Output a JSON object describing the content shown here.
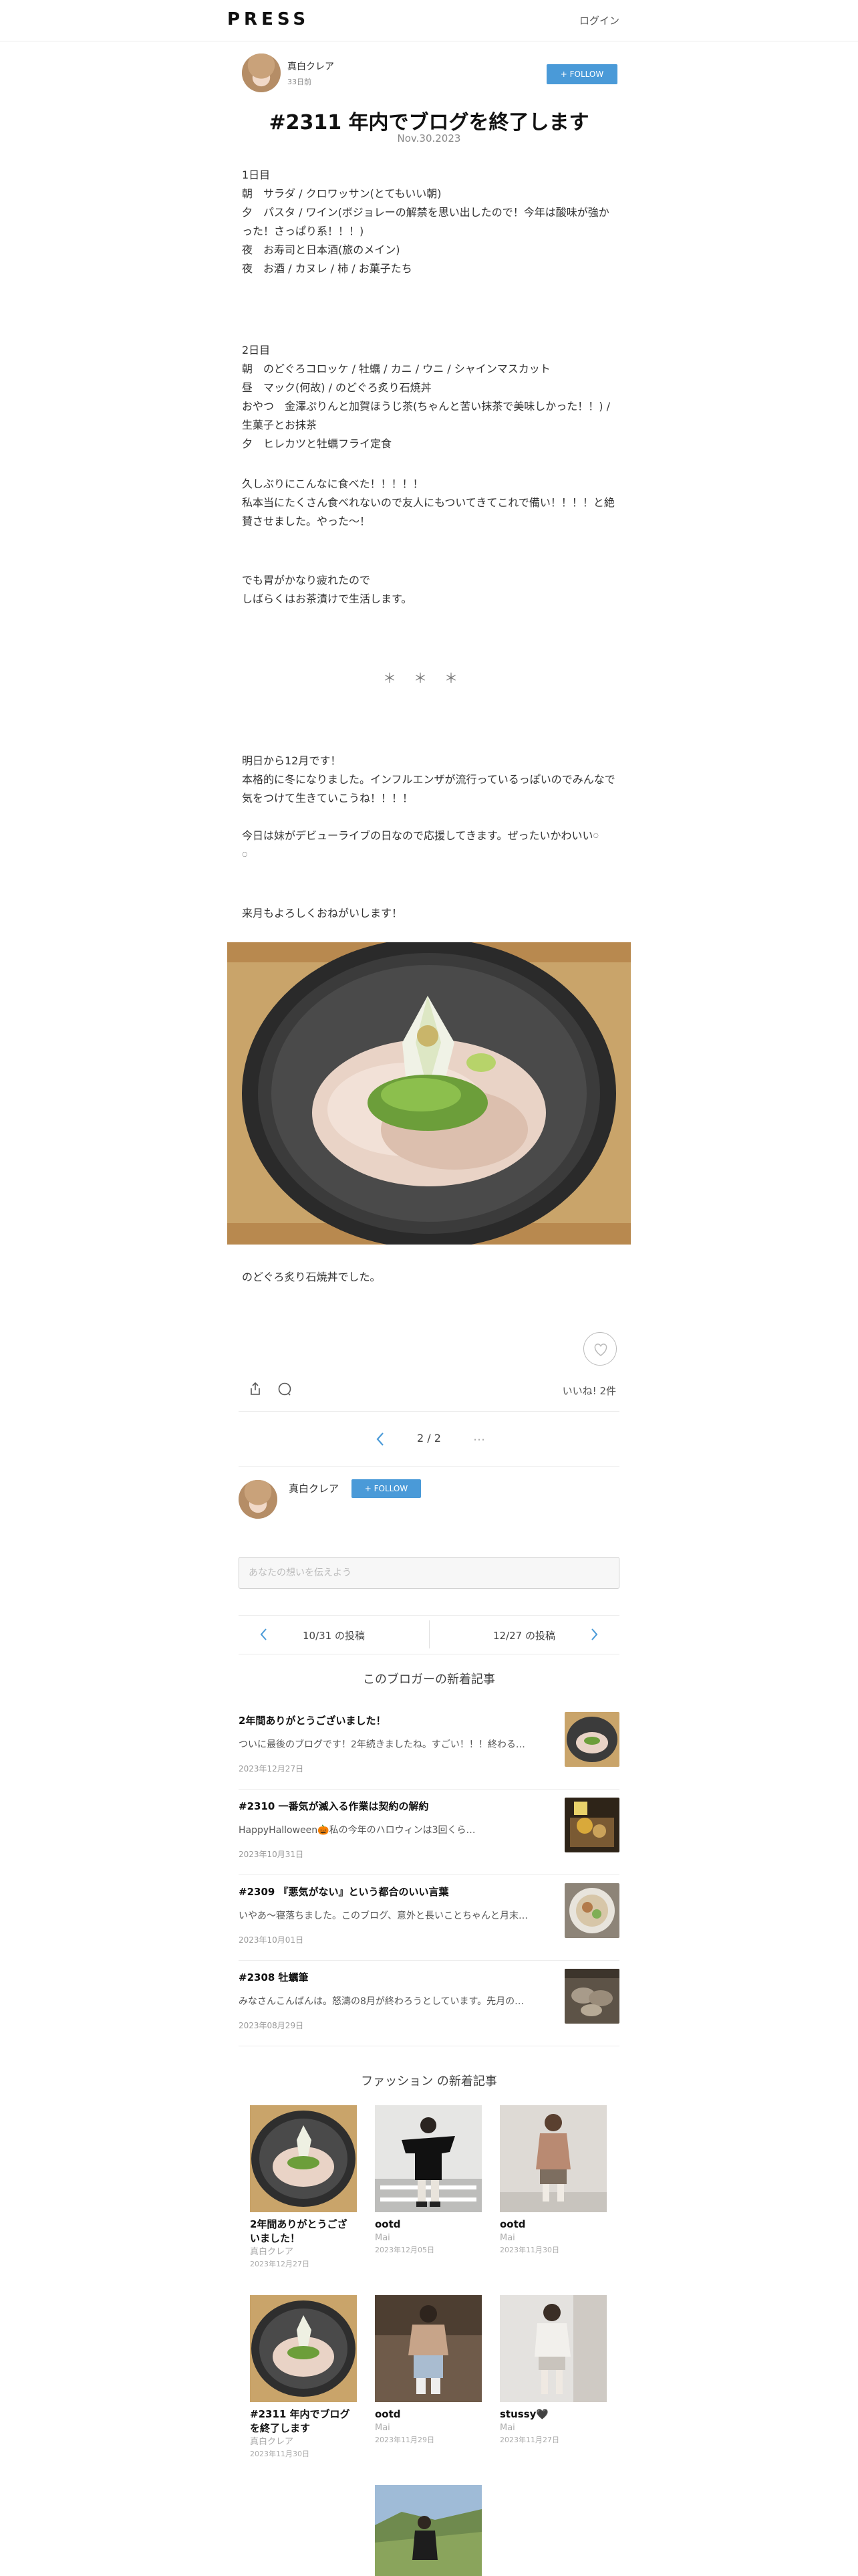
{
  "header": {
    "logo": "PRESS",
    "login": "ログイン"
  },
  "author": {
    "name": "真白クレア",
    "sub": "33日前",
    "follow": "+ FOLLOW"
  },
  "post": {
    "title": "#2311 年内でブログを終了します",
    "date": "Nov.30.2023",
    "para1": "1日目\n朝　サラダ / クロワッサン(とてもいい朝)\n夕　パスタ / ワイン(ボジョレーの解禁を思い出したので！今年は酸味が強かった！さっぱり系！！！)\n夜　お寿司と日本酒(旅のメイン)\n夜　お酒 / カヌレ / 柿 / お菓子たち",
    "para2": "2日目\n朝　のどぐろコロッケ / 牡蠣 / カニ / ウニ / シャインマスカット\n昼　マック(何故) / のどぐろ炙り石焼丼\nおやつ　金澤ぷりんと加賀ほうじ茶(ちゃんと苦い抹茶で美味しかった！！) / 生菓子とお抹茶\n夕　ヒレカツと牡蠣フライ定食",
    "para3": "久しぶりにこんなに食べた！！！！！\n私本当にたくさん食べれないので友人にもついてきてこれで備い！！！！と絶賛させました。やった〜！",
    "para4": "でも胃がかなり疲れたので\nしばらくはお茶漬けで生活します。",
    "stars": "＊＊＊",
    "para5": "明日から12月です！\n本格的に冬になりました。インフルエンザが流行っているっぽいのでみんなで気をつけて生きていこうね！！！！\n\n今日は妹がデビューライブの日なので応援してきます。ぜったいかわいい𓏸\n𓏸",
    "para6": "来月もよろしくおねがいします！",
    "caption": "のどぐろ炙り石焼丼でした。",
    "likes": "いいね! 2件"
  },
  "pager": {
    "current": "2 / 2",
    "more": "…"
  },
  "author_box": {
    "name": "真白クレア",
    "follow": "+ FOLLOW"
  },
  "comment": {
    "placeholder": "あなたの想いを伝えよう"
  },
  "post_nav": {
    "prev": "10/31 の投稿",
    "next": "12/27 の投稿"
  },
  "latest": {
    "title": "このブロガーの新着記事",
    "items": [
      {
        "title": "2年間ありがとうございました！",
        "excerpt": "ついに最後のブログです！2年続きましたね。すごい！！！終わる…",
        "date": "2023年12月27日"
      },
      {
        "title": "#2310 一番気が滅入る作業は契約の解約",
        "excerpt": "HappyHalloween🎃私の今年のハロウィンは3回くら…",
        "date": "2023年10月31日"
      },
      {
        "title": "#2309 『悪気がない』という都合のいい言葉",
        "excerpt": "いやあ〜寝落ちました。このブログ、意外と長いことちゃんと月末…",
        "date": "2023年10月01日"
      },
      {
        "title": "#2308 牡蠣筆",
        "excerpt": "みなさんこんばんは。怒濤の8月が終わろうとしています。先月の…",
        "date": "2023年08月29日"
      }
    ]
  },
  "fashion": {
    "title": "ファッション の新着記事",
    "cards": [
      {
        "title": "2年間ありがとうございました！",
        "author": "真白クレア",
        "date": "2023年12月27日"
      },
      {
        "title": "ootd",
        "author": "Mai",
        "date": "2023年12月05日"
      },
      {
        "title": "ootd",
        "author": "Mai",
        "date": "2023年11月30日"
      },
      {
        "title": "#2311 年内でブログを終了します",
        "author": "真白クレア",
        "date": "2023年11月30日"
      },
      {
        "title": "ootd",
        "author": "Mai",
        "date": "2023年11月29日"
      },
      {
        "title": "stussy🖤",
        "author": "Mai",
        "date": "2023年11月27日"
      },
      {
        "title": "",
        "author": "",
        "date": ""
      }
    ]
  }
}
